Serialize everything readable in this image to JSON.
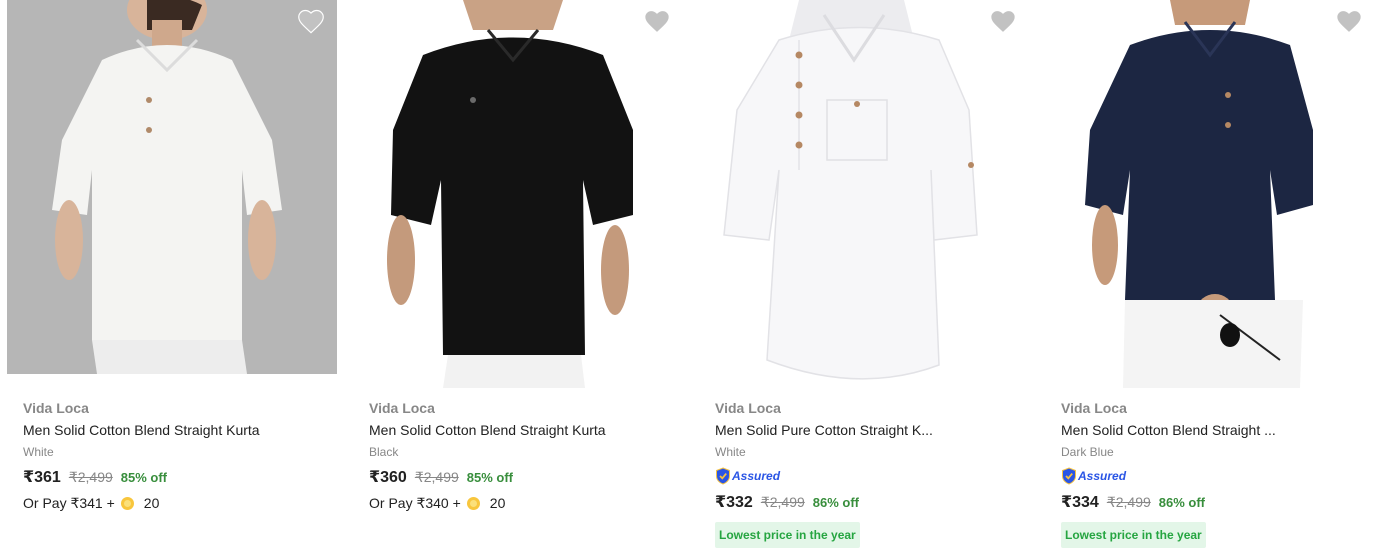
{
  "products": [
    {
      "brand": "Vida Loca",
      "title": "Men Solid Cotton Blend Straight Kurta",
      "color": "White",
      "price": "₹361",
      "mrp": "₹2,499",
      "discount": "85% off",
      "or_pay": "Or Pay ₹341 +",
      "coins": "20",
      "shirt_color": "#f4f4f2",
      "image_bg": "#b6b6b6"
    },
    {
      "brand": "Vida Loca",
      "title": "Men Solid Cotton Blend Straight Kurta",
      "color": "Black",
      "price": "₹360",
      "mrp": "₹2,499",
      "discount": "85% off",
      "or_pay": "Or Pay ₹340 +",
      "coins": "20",
      "shirt_color": "#121212",
      "image_bg": "#ffffff"
    },
    {
      "brand": "Vida Loca",
      "title": "Men Solid Pure Cotton Straight K...",
      "color": "White",
      "assured": "Assured",
      "price": "₹332",
      "mrp": "₹2,499",
      "discount": "86% off",
      "badge": "Lowest price in the year",
      "shirt_color": "#f7f7f9",
      "image_bg": "#ffffff"
    },
    {
      "brand": "Vida Loca",
      "title": "Men Solid Cotton Blend Straight ...",
      "color": "Dark Blue",
      "assured": "Assured",
      "price": "₹334",
      "mrp": "₹2,499",
      "discount": "86% off",
      "badge": "Lowest price in the year",
      "shirt_color": "#1c2642",
      "image_bg": "#ffffff"
    }
  ],
  "colors": {
    "discount_green": "#388e3c",
    "brand_gray": "#878787",
    "assured_blue": "#2a55e5",
    "badge_bg": "#e3f6e8",
    "badge_text": "#26a541",
    "wishlist_heart": "#c2c2c2"
  },
  "icons": {
    "wishlist": "heart-icon",
    "assured": "assured-shield-icon",
    "coin": "supercoin-icon"
  }
}
